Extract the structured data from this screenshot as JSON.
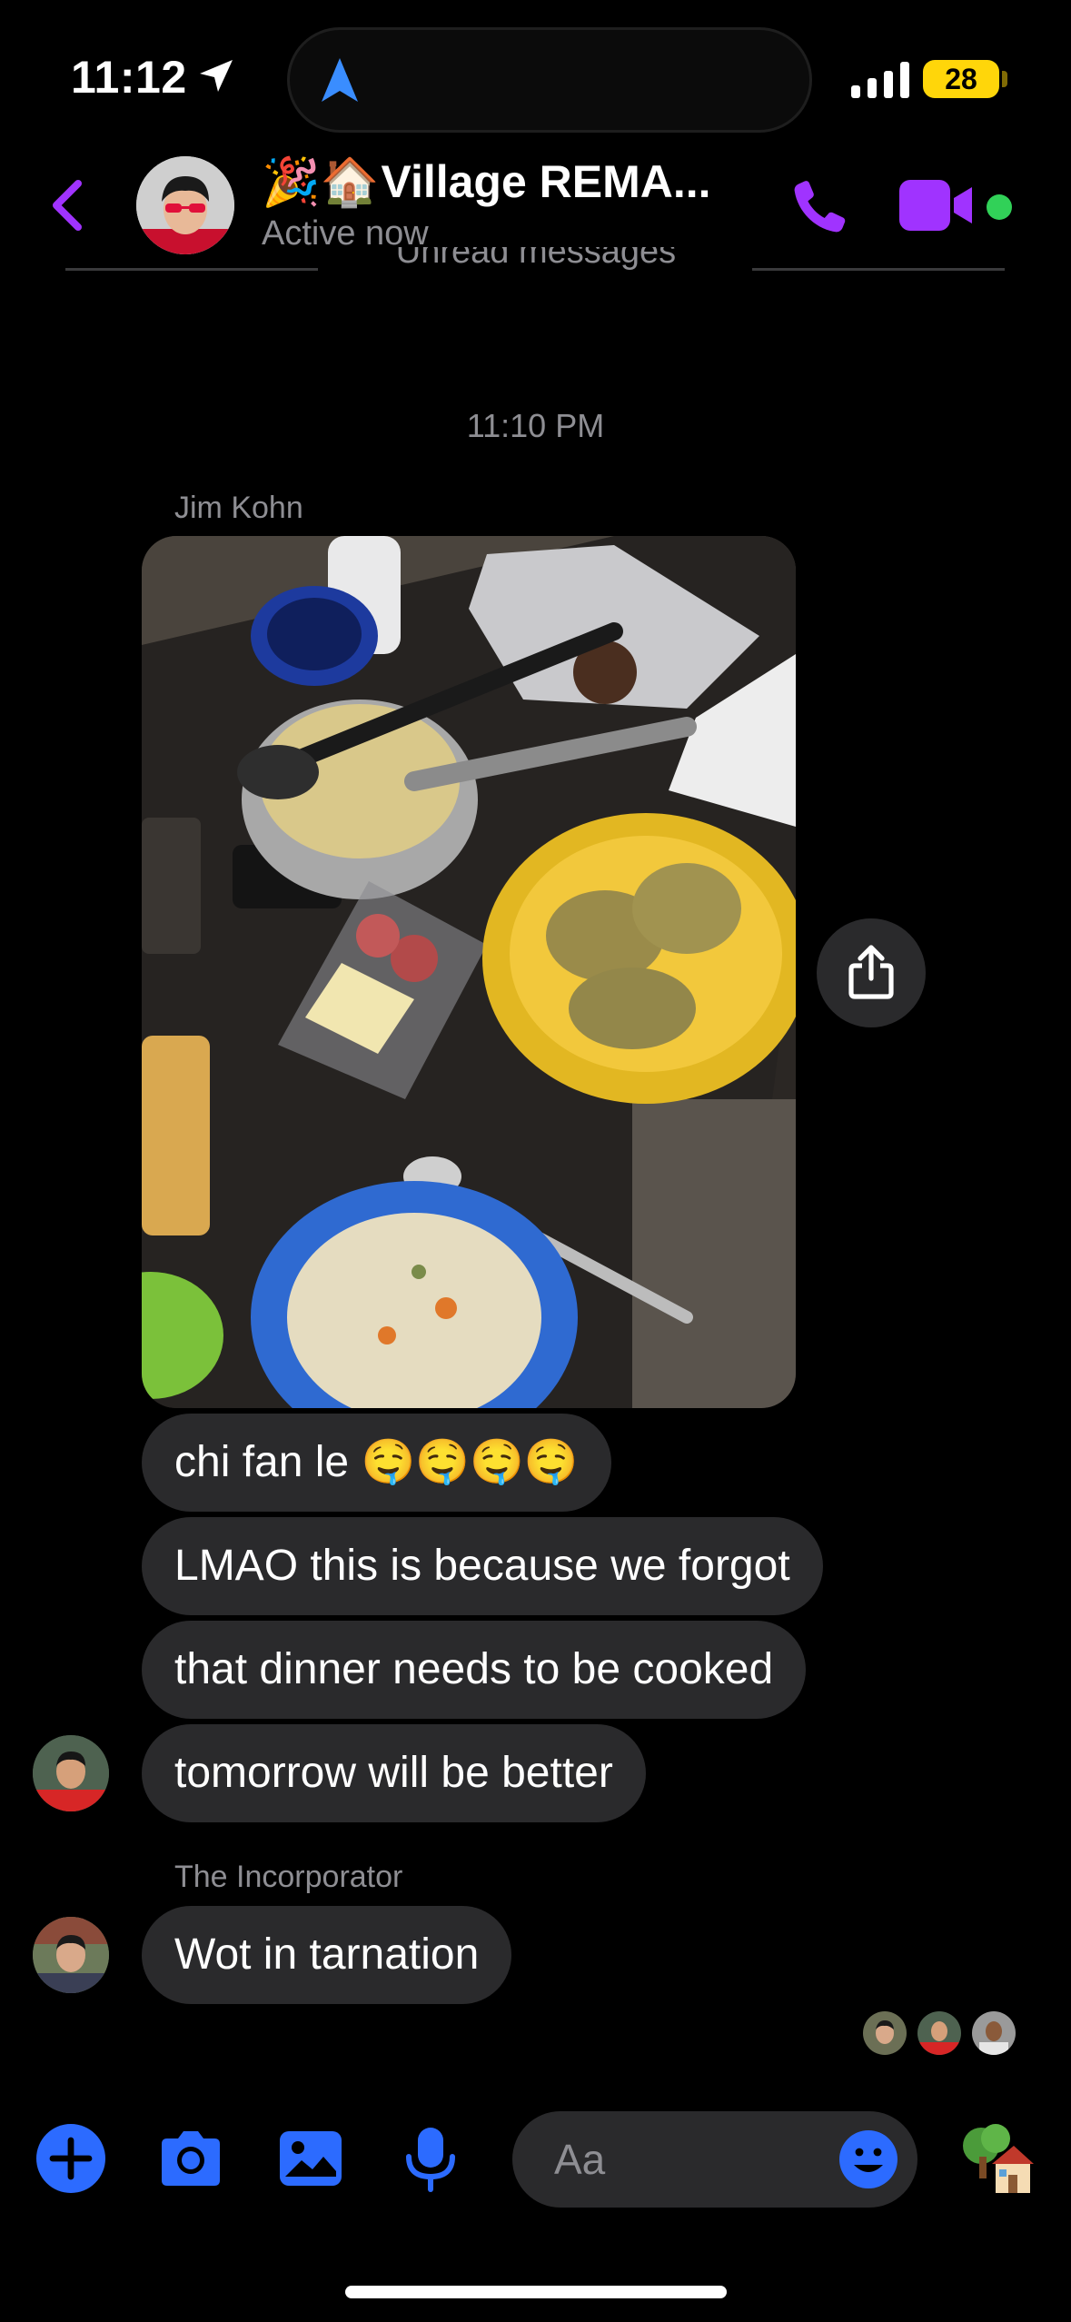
{
  "status_bar": {
    "time": "11:12",
    "battery": "28",
    "icons": [
      "location-arrow-icon",
      "navigation-arrow-icon",
      "cellular-signal-icon",
      "battery-icon"
    ]
  },
  "header": {
    "title_emoji": "🎉🏠",
    "title": "Village REMA...",
    "subtitle": "Active now",
    "icons": [
      "back-chevron-icon",
      "phone-icon",
      "video-camera-icon"
    ],
    "accent_color": "#a033ff",
    "online_color": "#31d158"
  },
  "thread": {
    "unread_label": "Unread messages",
    "timestamp": "11:10 PM",
    "group1_sender": "Jim Kohn",
    "messages": [
      "chi fan le 🤤🤤🤤🤤",
      "LMAO this is because we forgot",
      "that dinner needs to be cooked",
      "tomorrow will be better"
    ],
    "group2_sender": "The Incorporator",
    "group2_message": "Wot in tarnation",
    "bubble_color": "#2a2a2c"
  },
  "composer": {
    "placeholder": "Aa",
    "icons": [
      "plus-icon",
      "camera-icon",
      "gallery-icon",
      "microphone-icon",
      "emoji-icon",
      "house-tree-icon"
    ],
    "icon_color": "#2c6bff"
  }
}
